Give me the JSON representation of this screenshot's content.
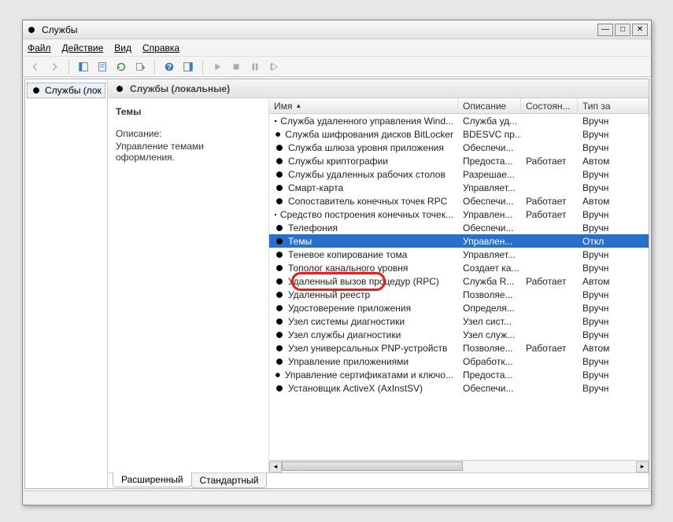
{
  "window": {
    "title": "Службы"
  },
  "menubar": {
    "file": "Файл",
    "action": "Действие",
    "view": "Вид",
    "help": "Справка"
  },
  "tree": {
    "root": "Службы (лок"
  },
  "pane": {
    "header": "Службы (локальные)"
  },
  "description": {
    "title": "Темы",
    "label": "Описание:",
    "text": "Управление темами оформления."
  },
  "columns": {
    "name": "Имя",
    "desc": "Описание",
    "state": "Состоян...",
    "type": "Тип за"
  },
  "tabs": {
    "extended": "Расширенный",
    "standard": "Стандартный"
  },
  "rows": [
    {
      "name": "Служба удаленного управления Wind...",
      "desc": "Служба уд...",
      "state": "",
      "type": "Вручн"
    },
    {
      "name": "Служба шифрования дисков BitLocker",
      "desc": "BDESVC пр...",
      "state": "",
      "type": "Вручн"
    },
    {
      "name": "Служба шлюза уровня приложения",
      "desc": "Обеспечи...",
      "state": "",
      "type": "Вручн"
    },
    {
      "name": "Службы криптографии",
      "desc": "Предоста...",
      "state": "Работает",
      "type": "Автом"
    },
    {
      "name": "Службы удаленных рабочих столов",
      "desc": "Разрешае...",
      "state": "",
      "type": "Вручн"
    },
    {
      "name": "Смарт-карта",
      "desc": "Управляет...",
      "state": "",
      "type": "Вручн"
    },
    {
      "name": "Сопоставитель конечных точек RPC",
      "desc": "Обеспечи...",
      "state": "Работает",
      "type": "Автом"
    },
    {
      "name": "Средство построения конечных точек...",
      "desc": "Управлен...",
      "state": "Работает",
      "type": "Вручн"
    },
    {
      "name": "Телефония",
      "desc": "Обеспечи...",
      "state": "",
      "type": "Вручн"
    },
    {
      "name": "Темы",
      "desc": "Управлен...",
      "state": "",
      "type": "Откл",
      "selected": true
    },
    {
      "name": "Теневое копирование тома",
      "desc": "Управляет...",
      "state": "",
      "type": "Вручн"
    },
    {
      "name": "Тополог канального уровня",
      "desc": "Создает ка...",
      "state": "",
      "type": "Вручн"
    },
    {
      "name": "Удаленный вызов процедур (RPC)",
      "desc": "Служба R...",
      "state": "Работает",
      "type": "Автом"
    },
    {
      "name": "Удаленный реестр",
      "desc": "Позволяе...",
      "state": "",
      "type": "Вручн"
    },
    {
      "name": "Удостоверение приложения",
      "desc": "Определя...",
      "state": "",
      "type": "Вручн"
    },
    {
      "name": "Узел системы диагностики",
      "desc": "Узел сист...",
      "state": "",
      "type": "Вручн"
    },
    {
      "name": "Узел службы диагностики",
      "desc": "Узел служ...",
      "state": "",
      "type": "Вручн"
    },
    {
      "name": "Узел универсальных PNP-устройств",
      "desc": "Позволяе...",
      "state": "Работает",
      "type": "Автом"
    },
    {
      "name": "Управление приложениями",
      "desc": "Обработк...",
      "state": "",
      "type": "Вручн"
    },
    {
      "name": "Управление сертификатами и ключо...",
      "desc": "Предоста...",
      "state": "",
      "type": "Вручн"
    },
    {
      "name": "Установщик ActiveX (AxInstSV)",
      "desc": "Обеспечи...",
      "state": "",
      "type": "Вручн"
    }
  ]
}
